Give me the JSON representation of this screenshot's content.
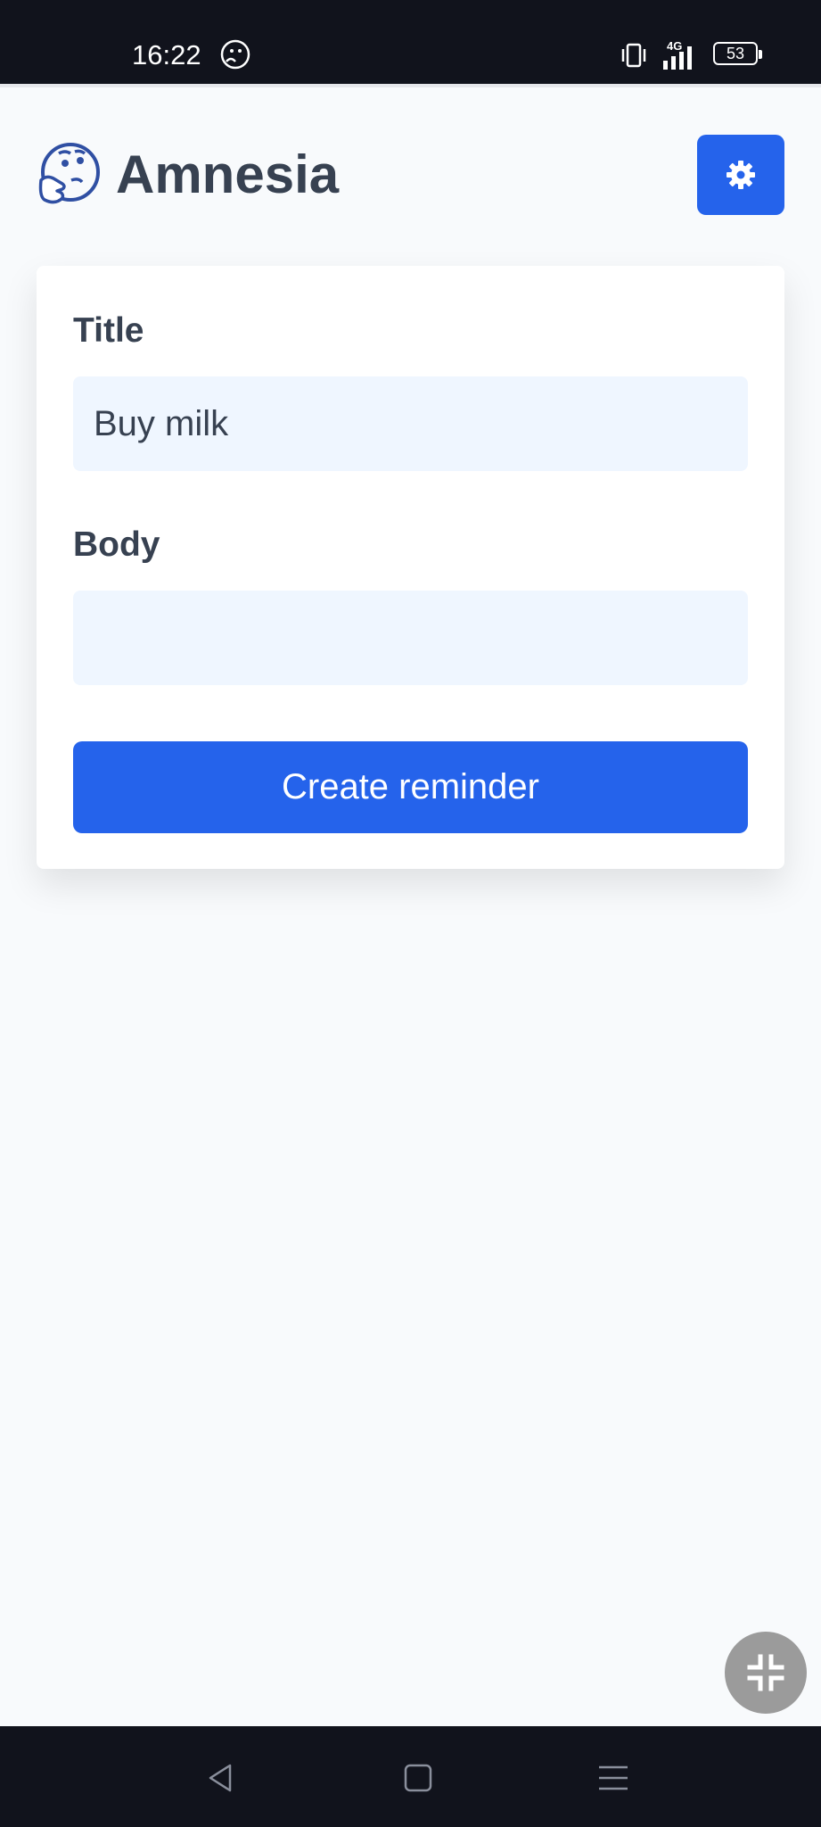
{
  "status_bar": {
    "time": "16:22",
    "network": "4G",
    "battery_level": "53"
  },
  "header": {
    "app_title": "Amnesia",
    "logo_icon": "thinking-face-icon",
    "settings_icon": "gear-icon"
  },
  "form": {
    "title_label": "Title",
    "title_value": "Buy milk",
    "body_label": "Body",
    "body_value": "",
    "submit_label": "Create reminder"
  },
  "floating_action": {
    "icon": "collapse-icon"
  },
  "nav_bar": {
    "icons": [
      "back-triangle-icon",
      "home-square-icon",
      "menu-lines-icon"
    ]
  },
  "colors": {
    "accent": "#2563eb",
    "input_background": "#eff6ff",
    "page_background": "#f8fafc",
    "text": "#374151",
    "system_bar": "#11131c"
  }
}
